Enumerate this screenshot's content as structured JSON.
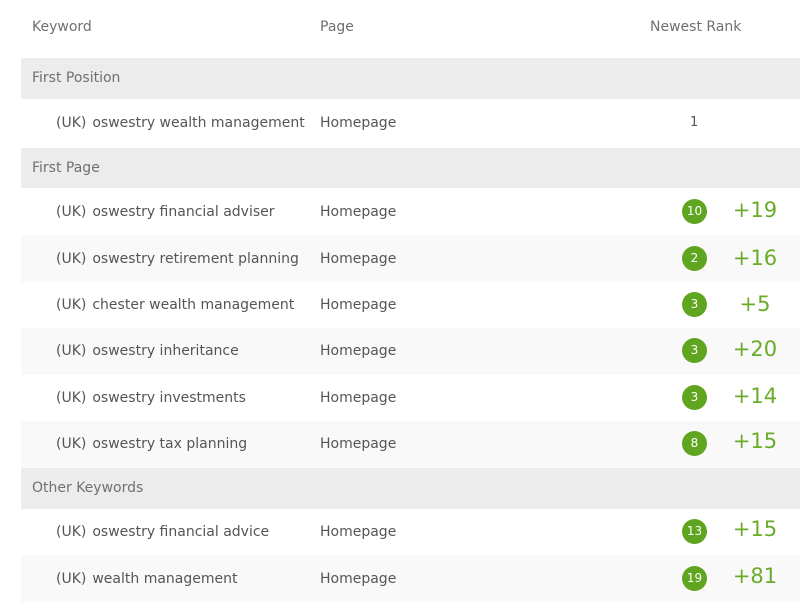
{
  "header": {
    "keyword": "Keyword",
    "page": "Page",
    "newest_rank": "Newest Rank"
  },
  "groups": {
    "first_position": {
      "label": "First Position",
      "rows": [
        {
          "location": "(UK)",
          "keyword": "oswestry wealth management",
          "page": "Homepage",
          "rank": "1",
          "change": ""
        }
      ]
    },
    "first_page": {
      "label": "First Page",
      "rows": [
        {
          "location": "(UK)",
          "keyword": "oswestry financial adviser",
          "page": "Homepage",
          "rank": "10",
          "change": "+19"
        },
        {
          "location": "(UK)",
          "keyword": "oswestry retirement planning",
          "page": "Homepage",
          "rank": "2",
          "change": "+16"
        },
        {
          "location": "(UK)",
          "keyword": "chester wealth management",
          "page": "Homepage",
          "rank": "3",
          "change": "+5"
        },
        {
          "location": "(UK)",
          "keyword": "oswestry inheritance",
          "page": "Homepage",
          "rank": "3",
          "change": "+20"
        },
        {
          "location": "(UK)",
          "keyword": "oswestry investments",
          "page": "Homepage",
          "rank": "3",
          "change": "+14"
        },
        {
          "location": "(UK)",
          "keyword": "oswestry tax planning",
          "page": "Homepage",
          "rank": "8",
          "change": "+15"
        }
      ]
    },
    "other_keywords": {
      "label": "Other Keywords",
      "rows": [
        {
          "location": "(UK)",
          "keyword": "oswestry financial advice",
          "page": "Homepage",
          "rank": "13",
          "change": "+15"
        },
        {
          "location": "(UK)",
          "keyword": "wealth management",
          "page": "Homepage",
          "rank": "19",
          "change": "+81"
        }
      ]
    }
  },
  "colors": {
    "badge": "#5fa51f",
    "change": "#6aab28",
    "group_bg": "#ececec"
  }
}
